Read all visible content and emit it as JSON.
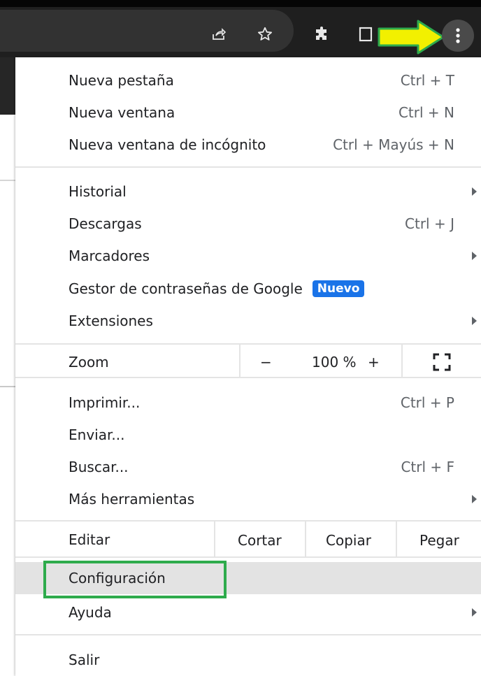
{
  "toolbar": {
    "icons": [
      "share-icon",
      "star-icon",
      "extensions-icon",
      "side-panel-icon",
      "more-vert-icon"
    ],
    "arrow_color": "#f2f000",
    "arrow_outline": "#2eab4c"
  },
  "menu": {
    "section1": [
      {
        "label": "Nueva pestaña",
        "shortcut": "Ctrl + T"
      },
      {
        "label": "Nueva ventana",
        "shortcut": "Ctrl + N"
      },
      {
        "label": "Nueva ventana de incógnito",
        "shortcut": "Ctrl + Mayús + N"
      }
    ],
    "section2": [
      {
        "label": "Historial",
        "has_submenu": true
      },
      {
        "label": "Descargas",
        "shortcut": "Ctrl + J"
      },
      {
        "label": "Marcadores",
        "has_submenu": true
      },
      {
        "label": "Gestor de contraseñas de Google",
        "badge": "Nuevo"
      },
      {
        "label": "Extensiones",
        "has_submenu": true
      }
    ],
    "zoom": {
      "label": "Zoom",
      "minus": "−",
      "value": "100 %",
      "plus": "+",
      "fullscreen_icon": "fullscreen-icon"
    },
    "section3": [
      {
        "label": "Imprimir...",
        "shortcut": "Ctrl + P"
      },
      {
        "label": "Enviar..."
      },
      {
        "label": "Buscar...",
        "shortcut": "Ctrl + F"
      },
      {
        "label": "Más herramientas",
        "has_submenu": true
      }
    ],
    "edit": {
      "label": "Editar",
      "cut": "Cortar",
      "copy": "Copiar",
      "paste": "Pegar"
    },
    "section4": [
      {
        "label": "Configuración",
        "highlighted": true
      },
      {
        "label": "Ayuda",
        "has_submenu": true
      }
    ],
    "section5": [
      {
        "label": "Salir"
      }
    ]
  },
  "colors": {
    "badge": "#1a73e8",
    "highlight_box": "#2eab4c",
    "hover": "#e3e3e3"
  }
}
